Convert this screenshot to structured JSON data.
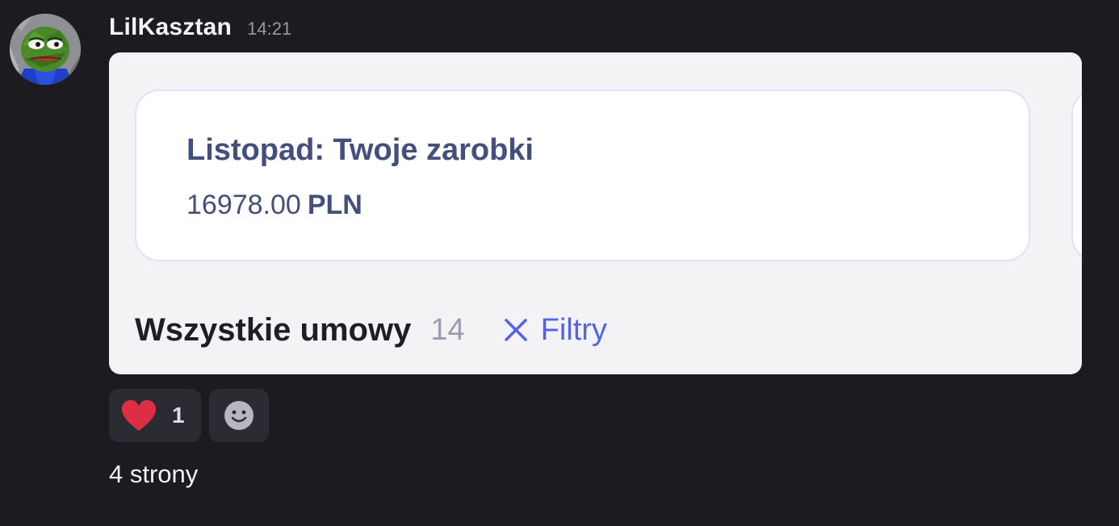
{
  "message": {
    "username": "LilKasztan",
    "timestamp": "14:21",
    "avatar_icon": "pepe-frog-avatar",
    "text": "4 strony"
  },
  "attachment": {
    "earnings_card": {
      "title": "Listopad: Twoje zarobki",
      "amount": "16978.00",
      "currency": "PLN"
    },
    "contracts": {
      "title": "Wszystkie umowy",
      "count": "14",
      "filters_label": "Filtry",
      "filters_icon": "close-icon"
    }
  },
  "reactions": [
    {
      "emoji": "heart",
      "count": "1"
    }
  ],
  "add_reaction_icon": "add-reaction-icon",
  "colors": {
    "background": "#1c1b20",
    "card_text": "#434f7d",
    "filter_accent": "#5563e6",
    "heart": "#dd2e44"
  }
}
